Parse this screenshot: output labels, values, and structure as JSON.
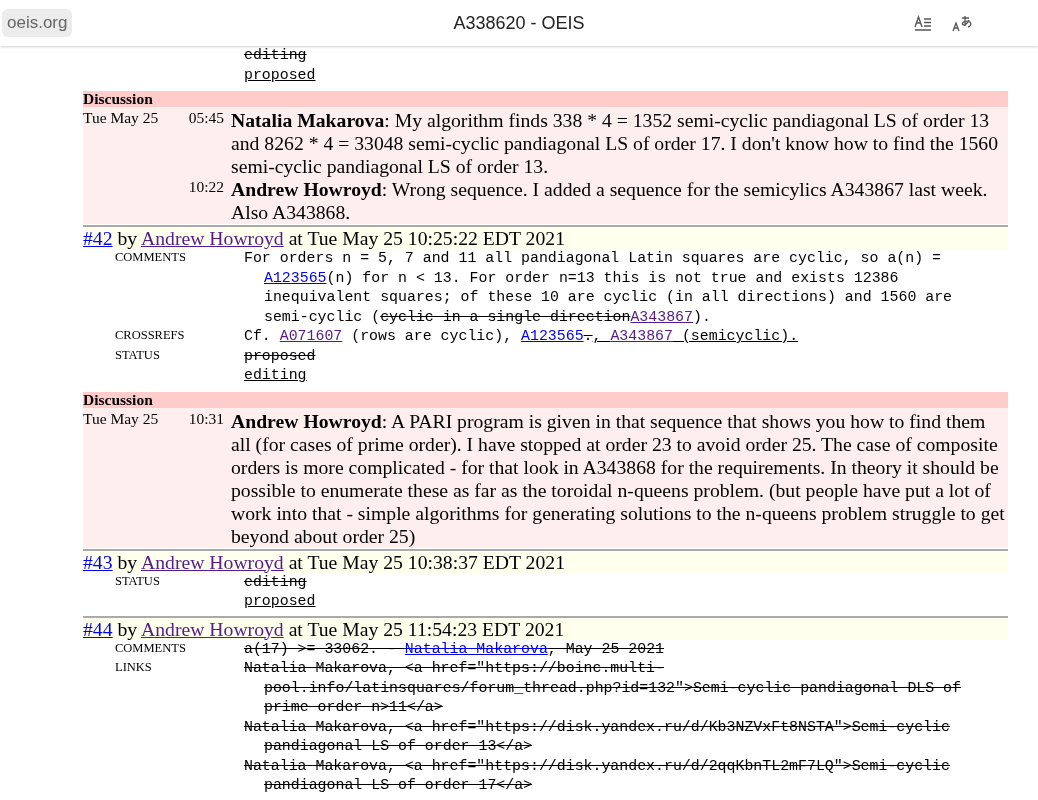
{
  "browser_bar": {
    "site": "oeis.org",
    "title": "A338620 - OEIS"
  },
  "blocks": [
    {
      "kind": "fields",
      "fields": [
        {
          "values": [
            [
              {
                "t": "editing",
                "kind": "del"
              }
            ],
            [
              {
                "t": "proposed",
                "kind": "ins"
              }
            ]
          ]
        }
      ]
    },
    {
      "kind": "discussion",
      "heading": "Discussion",
      "entries": [
        {
          "date": "Tue May 25",
          "time": "05:45",
          "text": "**Natalia Makarova**: My algorithm finds 338 * 4 = 1352 semi-cyclic pandiagonal LS of order 13 and 8262 * 4 = 33048 semi-cyclic pandiagonal LS of order 17. I don't know how to find the 1560 semi-cyclic pandiagonal LS of order 13."
        },
        {
          "time": "10:22",
          "text": "**Andrew Howroyd**: Wrong sequence. I added a sequence for the semicylics A343867 last week. Also A343868."
        }
      ]
    },
    {
      "kind": "edit",
      "header": [
        {
          "t": "#42",
          "kind": "link"
        },
        {
          "t": " by ",
          "kind": "plain"
        },
        {
          "t": "Andrew Howroyd",
          "kind": "visited"
        },
        {
          "t": " at Tue May 25 10:25:22 EDT 2021",
          "kind": "plain"
        }
      ],
      "fields": [
        {
          "label": "COMMENTS",
          "values": [
            [
              {
                "t": "For orders n = 5, 7 and 11 all pandiagonal Latin squares are cyclic, so a(n) = ",
                "kind": "plain"
              },
              {
                "t": "A123565",
                "kind": "link"
              },
              {
                "t": "(n) for n < 13. For order n=13 this is not true and exists 12386 inequivalent squares; of these 10 are cyclic (in all directions) and 1560 are semi-cyclic (",
                "kind": "plain"
              },
              {
                "t": "cyclic in a single direction",
                "kind": "del"
              },
              {
                "t": "A343867",
                "kind": "visited"
              },
              {
                "t": ").",
                "kind": "plain"
              }
            ]
          ]
        },
        {
          "label": "CROSSREFS",
          "values": [
            [
              {
                "t": "Cf. ",
                "kind": "plain"
              },
              {
                "t": "A071607",
                "kind": "visited"
              },
              {
                "t": " (rows are cyclic), ",
                "kind": "plain"
              },
              {
                "t": "A123565",
                "kind": "link"
              },
              {
                "t": ".",
                "kind": "del"
              },
              {
                "t": ", ",
                "kind": "ins"
              },
              {
                "t": "A343867",
                "kind": "visited"
              },
              {
                "t": " (semicyclic).",
                "kind": "ins"
              }
            ]
          ]
        },
        {
          "label": "STATUS",
          "values": [
            [
              {
                "t": "proposed",
                "kind": "del"
              }
            ],
            [
              {
                "t": "editing",
                "kind": "ins"
              }
            ]
          ]
        }
      ]
    },
    {
      "kind": "discussion",
      "heading": "Discussion",
      "entries": [
        {
          "date": "Tue May 25",
          "time": "10:31",
          "text": "**Andrew Howroyd**: A PARI program is given in that sequence that shows you how to find them all (for cases of prime order). I have stopped at order 23 to avoid order 25. The case of composite orders is more complicated - for that look in A343868 for the requirements. In theory it should be possible to enumerate these as far as the toroidal n-queens problem. (but people have put a lot of work into that - simple algorithms for generating solutions to the n-queens problem struggle to get beyond about order 25)"
        }
      ]
    },
    {
      "kind": "edit",
      "header": [
        {
          "t": "#43",
          "kind": "link"
        },
        {
          "t": " by ",
          "kind": "plain"
        },
        {
          "t": "Andrew Howroyd",
          "kind": "visited"
        },
        {
          "t": " at Tue May 25 10:38:37 EDT 2021",
          "kind": "plain"
        }
      ],
      "fields": [
        {
          "label": "STATUS",
          "values": [
            [
              {
                "t": "editing",
                "kind": "del"
              }
            ],
            [
              {
                "t": "proposed",
                "kind": "ins"
              }
            ]
          ]
        }
      ]
    },
    {
      "kind": "edit",
      "header": [
        {
          "t": "#44",
          "kind": "link"
        },
        {
          "t": " by ",
          "kind": "plain"
        },
        {
          "t": "Andrew Howroyd",
          "kind": "visited"
        },
        {
          "t": " at Tue May 25 11:54:23 EDT 2021",
          "kind": "plain"
        }
      ],
      "fields": [
        {
          "label": "COMMENTS",
          "values": [
            [
              {
                "t": "a(17) >= 33062. - ",
                "kind": "del"
              },
              {
                "t": "Natalia Makarova",
                "kind": "del-link"
              },
              {
                "t": ", May 25 2021",
                "kind": "del"
              }
            ]
          ]
        },
        {
          "label": "LINKS",
          "values": [
            [
              {
                "t": "Natalia Makarova, <a href=\"https://boinc.multi-pool.info/latinsquares/forum_thread.php?id=132\">Semi-cyclic pandiagonal DLS of prime order n>11</a>",
                "kind": "del"
              }
            ],
            [
              {
                "t": "Natalia Makarova, <a href=\"https://disk.yandex.ru/d/Kb3NZVxFt8NSTA\">Semi-cyclic pandiagonal LS of order 13</a>",
                "kind": "del"
              }
            ],
            [
              {
                "t": "Natalia Makarova, <a href=\"https://disk.yandex.ru/d/2qqKbnTL2mF7LQ\">Semi-cyclic pandiagonal LS of order 17</a>",
                "kind": "del"
              }
            ]
          ]
        }
      ]
    }
  ]
}
